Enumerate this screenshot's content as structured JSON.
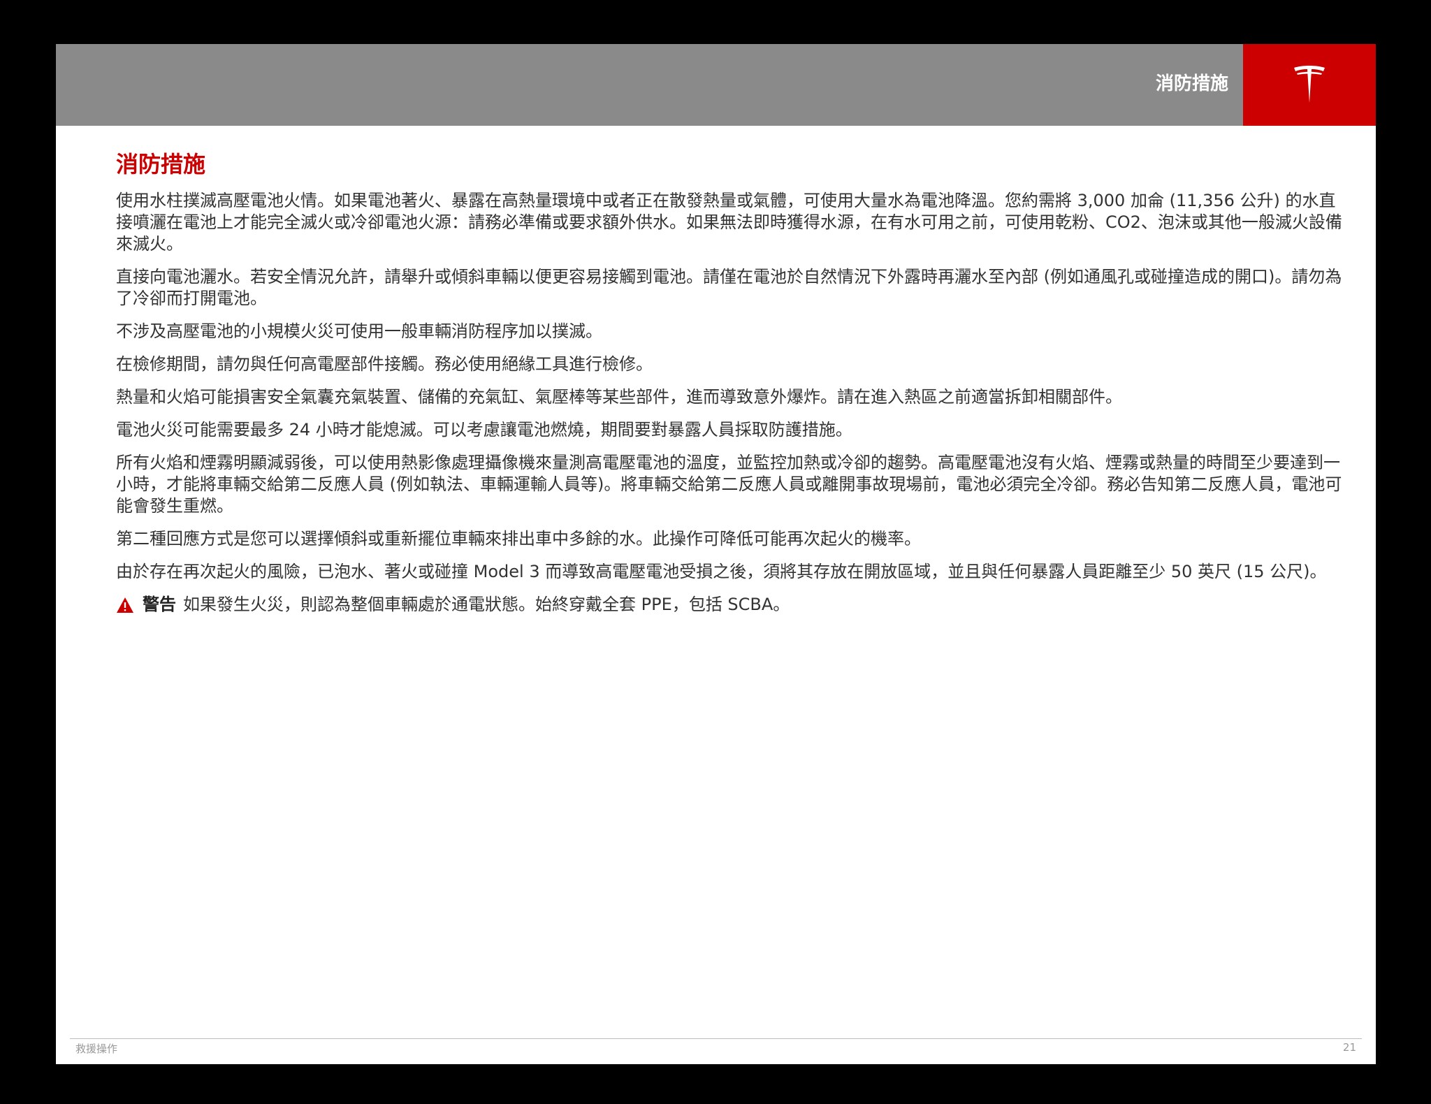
{
  "header": {
    "title": "消防措施",
    "logo": "tesla-t-logo",
    "bar_color": "#8a8a8a",
    "logo_box_color": "#cc0000"
  },
  "section": {
    "title": "消防措施",
    "title_color": "#cc0000",
    "paragraphs": [
      "使用水柱撲滅高壓電池火情。如果電池著火、暴露在高熱量環境中或者正在散發熱量或氣體，可使用大量水為電池降溫。您約需將 3,000 加侖 (11,356 公升) 的水直接噴灑在電池上才能完全滅火或冷卻電池火源：請務必準備或要求額外供水。如果無法即時獲得水源，在有水可用之前，可使用乾粉、CO2、泡沫或其他一般滅火設備來滅火。",
      "直接向電池灑水。若安全情況允許，請舉升或傾斜車輛以便更容易接觸到電池。請僅在電池於自然情況下外露時再灑水至內部 (例如通風孔或碰撞造成的開口)。請勿為了冷卻而打開電池。",
      "不涉及高壓電池的小規模火災可使用一般車輛消防程序加以撲滅。",
      "在檢修期間，請勿與任何高電壓部件接觸。務必使用絕緣工具進行檢修。",
      "熱量和火焰可能損害安全氣囊充氣裝置、儲備的充氣缸、氣壓棒等某些部件，進而導致意外爆炸。請在進入熱區之前適當拆卸相關部件。",
      "電池火災可能需要最多 24 小時才能熄滅。可以考慮讓電池燃燒，期間要對暴露人員採取防護措施。",
      "所有火焰和煙霧明顯減弱後，可以使用熱影像處理攝像機來量測高電壓電池的溫度，並監控加熱或冷卻的趨勢。高電壓電池沒有火焰、煙霧或熱量的時間至少要達到一小時，才能將車輛交給第二反應人員 (例如執法、車輛運輸人員等)。將車輛交給第二反應人員或離開事故現場前，電池必須完全冷卻。務必告知第二反應人員，電池可能會發生重燃。",
      "第二種回應方式是您可以選擇傾斜或重新擺位車輛來排出車中多餘的水。此操作可降低可能再次起火的機率。",
      "由於存在再次起火的風險，已泡水、著火或碰撞 Model 3 而導致高電壓電池受損之後，須將其存放在開放區域，並且與任何暴露人員距離至少 50 英尺 (15 公尺)。"
    ],
    "warning": {
      "icon": "warning-triangle-icon",
      "label": "警告",
      "text": "如果發生火災，則認為整個車輛處於通電狀態。始終穿戴全套 PPE，包括 SCBA。"
    }
  },
  "footer": {
    "left": "救援操作",
    "page_number": "21"
  }
}
